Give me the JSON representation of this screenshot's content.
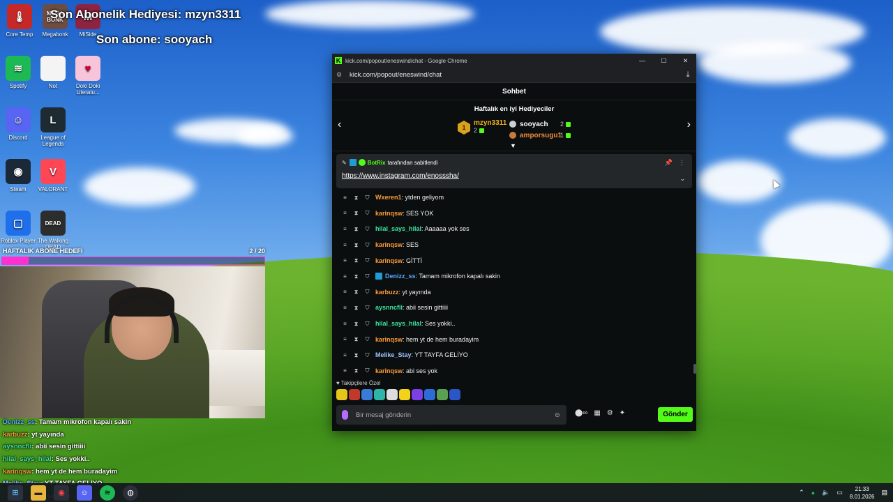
{
  "desktop": {
    "icons": [
      {
        "label": "Core Temp",
        "icon": "core-temp-icon",
        "color": "#c62828",
        "glyph": "🌡"
      },
      {
        "label": "Megabonk",
        "icon": "megabonk-icon",
        "color": "#6d4c41",
        "glyph": "MEGA BONK"
      },
      {
        "label": "MiSide",
        "icon": "miside-icon",
        "color": "#8e2442",
        "glyph": "M"
      },
      {
        "label": "Spotify",
        "icon": "spotify-icon",
        "color": "#1db954",
        "glyph": "≋"
      },
      {
        "label": "Not",
        "icon": "text-file-icon",
        "color": "#f4f4f4",
        "glyph": ""
      },
      {
        "label": "Doki Doki Literatu...",
        "icon": "doki-doki-icon",
        "color": "#f7c4da",
        "glyph": "♥"
      },
      {
        "label": "Discord",
        "icon": "discord-icon",
        "color": "#5865f2",
        "glyph": "☺"
      },
      {
        "label": "League of Legends",
        "icon": "league-of-legends-icon",
        "color": "#1e2b33",
        "glyph": "L"
      },
      {
        "label": "Steam",
        "icon": "steam-icon",
        "color": "#1b2838",
        "glyph": "◉"
      },
      {
        "label": "VALORANT",
        "icon": "valorant-icon",
        "color": "#ff4655",
        "glyph": "V"
      },
      {
        "label": "Roblox Player",
        "icon": "roblox-icon",
        "color": "#1f6feb",
        "glyph": "▢"
      },
      {
        "label": "The Walking DEAD",
        "icon": "walking-dead-icon",
        "color": "#2d2d2d",
        "glyph": "DEAD"
      }
    ]
  },
  "overlay": {
    "last_gift": "Son Abonelik Hediyesi: mzyn3311",
    "last_sub": "Son abone: sooyach",
    "goal_label": "HAFTALIK ABONE HEDEFİ",
    "goal_count": "2 / 20",
    "goal_progress": 0.1,
    "chat": [
      {
        "user": "Denizz_ss",
        "text": ": Tamam mikrofon kapalı sakin",
        "color": "#5aa6ff"
      },
      {
        "user": "karbuzz",
        "text": ": yt yayında",
        "color": "#ff9a3c"
      },
      {
        "user": "aysnncfli",
        "text": ": abii sesin gittiiii",
        "color": "#3ee6a0"
      },
      {
        "user": "hilal_says_hilal",
        "text": ": Ses yokki..",
        "color": "#3ee6a0"
      },
      {
        "user": "karinqsw",
        "text": ": hem yt de hem buradayim",
        "color": "#ff9a3c"
      },
      {
        "user": "Melike_Stay",
        "text": ": YT TAYFA GELİYO",
        "color": "#9ec3ff"
      },
      {
        "user": "karinqsw",
        "text": ": abi ses yok",
        "color": "#ff9a3c"
      }
    ]
  },
  "browser": {
    "window_title": "kick.com/popout/eneswind/chat - Google Chrome",
    "url": "kick.com/popout/eneswind/chat",
    "chat_header": "Sohbet",
    "gifters_title": "Haftalık en iyi Hediyeciler",
    "top_gifter": {
      "rank": "1",
      "name": "mzyn3311",
      "count": "2"
    },
    "other_gifters": [
      {
        "name": "sooyach",
        "count": "2",
        "color": "#ffffff",
        "medal_color": "#cfcfcf"
      },
      {
        "name": "amporsugu1",
        "count": "1",
        "color": "#f08c3a",
        "medal_color": "#c77a3a"
      }
    ],
    "pinned": {
      "bot": "BotRix",
      "pinned_by_text": "tarafından sabitlendi",
      "link": "https://www.instagram.com/enosssha/"
    },
    "messages": [
      {
        "user": "Wxeren1",
        "text": ": ytden geliyom",
        "color": "#ff9a3c",
        "bot_badge": false
      },
      {
        "user": "karinqsw",
        "text": ": SES YOK",
        "color": "#ff9a3c",
        "bot_badge": false
      },
      {
        "user": "hilal_says_hilal",
        "text": ": Aaaaaa yok ses",
        "color": "#3ee6a0",
        "bot_badge": false
      },
      {
        "user": "karinqsw",
        "text": ": SES",
        "color": "#ff9a3c",
        "bot_badge": false
      },
      {
        "user": "karinqsw",
        "text": ": GİTTİ",
        "color": "#ff9a3c",
        "bot_badge": false
      },
      {
        "user": "Denizz_ss",
        "text": ": Tamam mikrofon kapalı sakin",
        "color": "#5aa6ff",
        "bot_badge": true
      },
      {
        "user": "karbuzz",
        "text": ": yt yayında",
        "color": "#ff9a3c",
        "bot_badge": false
      },
      {
        "user": "aysnncfli",
        "text": ": abii sesin gittiiii",
        "color": "#3ee6a0",
        "bot_badge": false
      },
      {
        "user": "hilal_says_hilal",
        "text": ": Ses yokki..",
        "color": "#3ee6a0",
        "bot_badge": false
      },
      {
        "user": "karinqsw",
        "text": ": hem yt de hem buradayim",
        "color": "#ff9a3c",
        "bot_badge": false
      },
      {
        "user": "Melike_Stay",
        "text": ": YT TAYFA GELİYO",
        "color": "#9ec3ff",
        "bot_badge": false
      },
      {
        "user": "karinqsw",
        "text": ": abi ses yok",
        "color": "#ff9a3c",
        "bot_badge": false
      }
    ],
    "emote_section": "Takipçilere Özel",
    "input_placeholder": "Bir mesaj gönderin",
    "send_label": "Gönder"
  },
  "taskbar": {
    "time": "21:33",
    "date": "8.01.2026"
  },
  "colors": {
    "kick_green": "#53fc18",
    "goal_pink": "#ff2fd0"
  }
}
